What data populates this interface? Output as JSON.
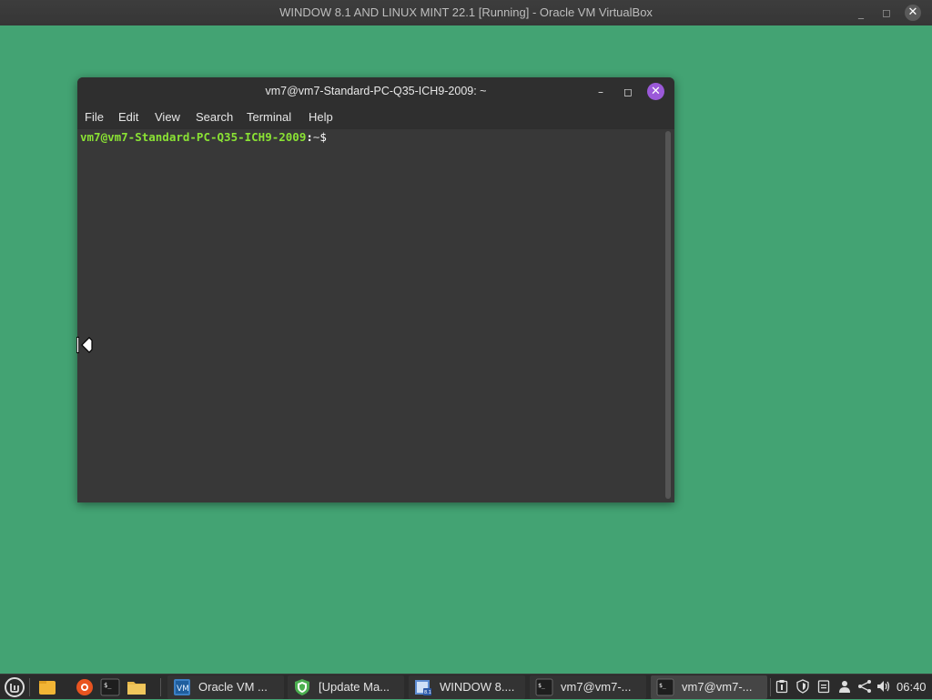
{
  "host": {
    "title": "WINDOW 8.1 AND LINUX MINT 22.1 [Running] - Oracle VM VirtualBox",
    "min_glyph": "_",
    "max_glyph": "◻",
    "close_glyph": "✕"
  },
  "terminal": {
    "title": "vm7@vm7-Standard-PC-Q35-ICH9-2009: ~",
    "min_glyph": "–",
    "max_glyph": "◻",
    "close_glyph": "✕",
    "menu": [
      "File",
      "Edit",
      "View",
      "Search",
      "Terminal",
      "Help"
    ],
    "prompt": {
      "user_host": "vm7@vm7-Standard-PC-Q35-ICH9-2009",
      "separator": ":",
      "path": "~",
      "symbol": "$"
    }
  },
  "taskbar": {
    "launchers": [
      "mint-menu-icon",
      "files-icon",
      "firefox-icon",
      "terminal-icon",
      "folder-icon"
    ],
    "windows": [
      {
        "label": "Oracle VM ...",
        "icon": "virtualbox-icon",
        "active": false
      },
      {
        "label": "[Update Ma...",
        "icon": "update-shield-icon",
        "active": false
      },
      {
        "label": "WINDOW 8....",
        "icon": "vm-window-icon",
        "active": false
      },
      {
        "label": "vm7@vm7-...",
        "icon": "terminal-icon",
        "active": false
      },
      {
        "label": "vm7@vm7-...",
        "icon": "terminal-icon",
        "active": true
      }
    ],
    "tray": [
      "clipboard-icon",
      "shield-icon",
      "notes-icon",
      "user-icon",
      "network-icon",
      "volume-icon"
    ],
    "clock": "06:40"
  },
  "colors": {
    "desktop": "#43a373",
    "prompt_user": "#8ae234",
    "close_accent": "#9b59d9"
  }
}
